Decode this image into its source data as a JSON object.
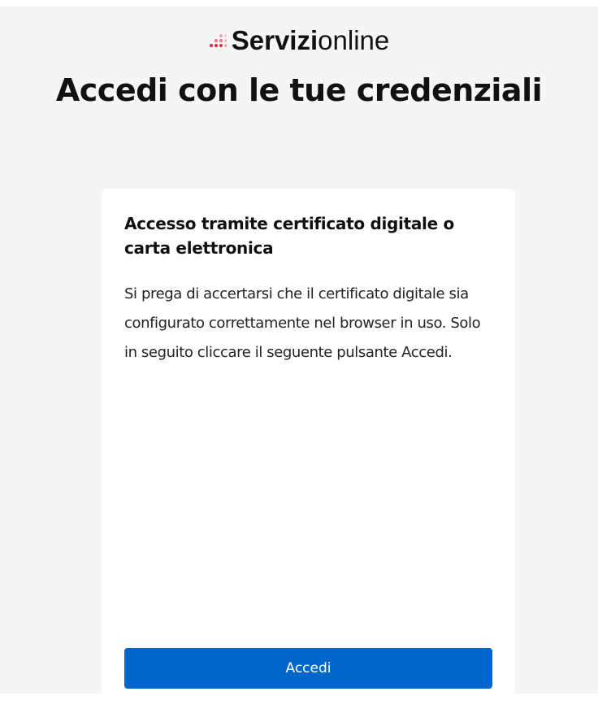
{
  "header": {
    "logo_bold": "Servizi",
    "logo_light": "online",
    "title": "Accedi con le tue credenziali"
  },
  "card": {
    "title": "Accesso tramite certificato digitale o carta elettronica",
    "body": "Si prega di accertarsi che il certificato digitale sia configurato correttamente nel browser in uso. Solo in seguito cliccare il seguente pulsante Accedi.",
    "button_label": "Accedi"
  },
  "colors": {
    "accent": "#0066cc",
    "logo_dots": "#e3263a",
    "background": "#f5f5f5"
  }
}
